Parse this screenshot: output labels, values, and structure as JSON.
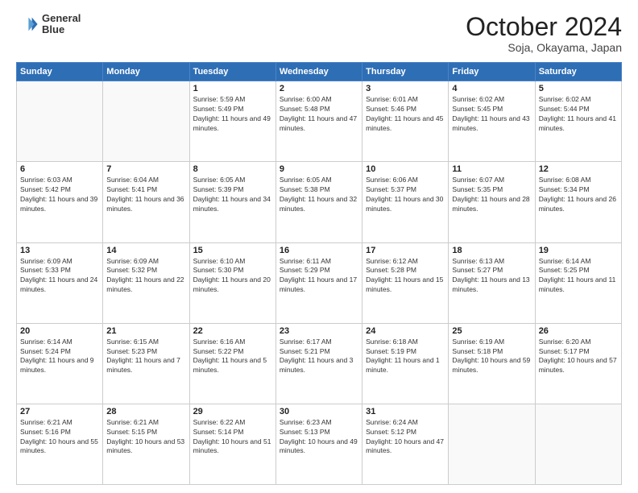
{
  "header": {
    "logo_line1": "General",
    "logo_line2": "Blue",
    "month": "October 2024",
    "location": "Soja, Okayama, Japan"
  },
  "weekdays": [
    "Sunday",
    "Monday",
    "Tuesday",
    "Wednesday",
    "Thursday",
    "Friday",
    "Saturday"
  ],
  "weeks": [
    [
      {
        "day": "",
        "info": ""
      },
      {
        "day": "",
        "info": ""
      },
      {
        "day": "1",
        "info": "Sunrise: 5:59 AM\nSunset: 5:49 PM\nDaylight: 11 hours and 49 minutes."
      },
      {
        "day": "2",
        "info": "Sunrise: 6:00 AM\nSunset: 5:48 PM\nDaylight: 11 hours and 47 minutes."
      },
      {
        "day": "3",
        "info": "Sunrise: 6:01 AM\nSunset: 5:46 PM\nDaylight: 11 hours and 45 minutes."
      },
      {
        "day": "4",
        "info": "Sunrise: 6:02 AM\nSunset: 5:45 PM\nDaylight: 11 hours and 43 minutes."
      },
      {
        "day": "5",
        "info": "Sunrise: 6:02 AM\nSunset: 5:44 PM\nDaylight: 11 hours and 41 minutes."
      }
    ],
    [
      {
        "day": "6",
        "info": "Sunrise: 6:03 AM\nSunset: 5:42 PM\nDaylight: 11 hours and 39 minutes."
      },
      {
        "day": "7",
        "info": "Sunrise: 6:04 AM\nSunset: 5:41 PM\nDaylight: 11 hours and 36 minutes."
      },
      {
        "day": "8",
        "info": "Sunrise: 6:05 AM\nSunset: 5:39 PM\nDaylight: 11 hours and 34 minutes."
      },
      {
        "day": "9",
        "info": "Sunrise: 6:05 AM\nSunset: 5:38 PM\nDaylight: 11 hours and 32 minutes."
      },
      {
        "day": "10",
        "info": "Sunrise: 6:06 AM\nSunset: 5:37 PM\nDaylight: 11 hours and 30 minutes."
      },
      {
        "day": "11",
        "info": "Sunrise: 6:07 AM\nSunset: 5:35 PM\nDaylight: 11 hours and 28 minutes."
      },
      {
        "day": "12",
        "info": "Sunrise: 6:08 AM\nSunset: 5:34 PM\nDaylight: 11 hours and 26 minutes."
      }
    ],
    [
      {
        "day": "13",
        "info": "Sunrise: 6:09 AM\nSunset: 5:33 PM\nDaylight: 11 hours and 24 minutes."
      },
      {
        "day": "14",
        "info": "Sunrise: 6:09 AM\nSunset: 5:32 PM\nDaylight: 11 hours and 22 minutes."
      },
      {
        "day": "15",
        "info": "Sunrise: 6:10 AM\nSunset: 5:30 PM\nDaylight: 11 hours and 20 minutes."
      },
      {
        "day": "16",
        "info": "Sunrise: 6:11 AM\nSunset: 5:29 PM\nDaylight: 11 hours and 17 minutes."
      },
      {
        "day": "17",
        "info": "Sunrise: 6:12 AM\nSunset: 5:28 PM\nDaylight: 11 hours and 15 minutes."
      },
      {
        "day": "18",
        "info": "Sunrise: 6:13 AM\nSunset: 5:27 PM\nDaylight: 11 hours and 13 minutes."
      },
      {
        "day": "19",
        "info": "Sunrise: 6:14 AM\nSunset: 5:25 PM\nDaylight: 11 hours and 11 minutes."
      }
    ],
    [
      {
        "day": "20",
        "info": "Sunrise: 6:14 AM\nSunset: 5:24 PM\nDaylight: 11 hours and 9 minutes."
      },
      {
        "day": "21",
        "info": "Sunrise: 6:15 AM\nSunset: 5:23 PM\nDaylight: 11 hours and 7 minutes."
      },
      {
        "day": "22",
        "info": "Sunrise: 6:16 AM\nSunset: 5:22 PM\nDaylight: 11 hours and 5 minutes."
      },
      {
        "day": "23",
        "info": "Sunrise: 6:17 AM\nSunset: 5:21 PM\nDaylight: 11 hours and 3 minutes."
      },
      {
        "day": "24",
        "info": "Sunrise: 6:18 AM\nSunset: 5:19 PM\nDaylight: 11 hours and 1 minute."
      },
      {
        "day": "25",
        "info": "Sunrise: 6:19 AM\nSunset: 5:18 PM\nDaylight: 10 hours and 59 minutes."
      },
      {
        "day": "26",
        "info": "Sunrise: 6:20 AM\nSunset: 5:17 PM\nDaylight: 10 hours and 57 minutes."
      }
    ],
    [
      {
        "day": "27",
        "info": "Sunrise: 6:21 AM\nSunset: 5:16 PM\nDaylight: 10 hours and 55 minutes."
      },
      {
        "day": "28",
        "info": "Sunrise: 6:21 AM\nSunset: 5:15 PM\nDaylight: 10 hours and 53 minutes."
      },
      {
        "day": "29",
        "info": "Sunrise: 6:22 AM\nSunset: 5:14 PM\nDaylight: 10 hours and 51 minutes."
      },
      {
        "day": "30",
        "info": "Sunrise: 6:23 AM\nSunset: 5:13 PM\nDaylight: 10 hours and 49 minutes."
      },
      {
        "day": "31",
        "info": "Sunrise: 6:24 AM\nSunset: 5:12 PM\nDaylight: 10 hours and 47 minutes."
      },
      {
        "day": "",
        "info": ""
      },
      {
        "day": "",
        "info": ""
      }
    ]
  ]
}
